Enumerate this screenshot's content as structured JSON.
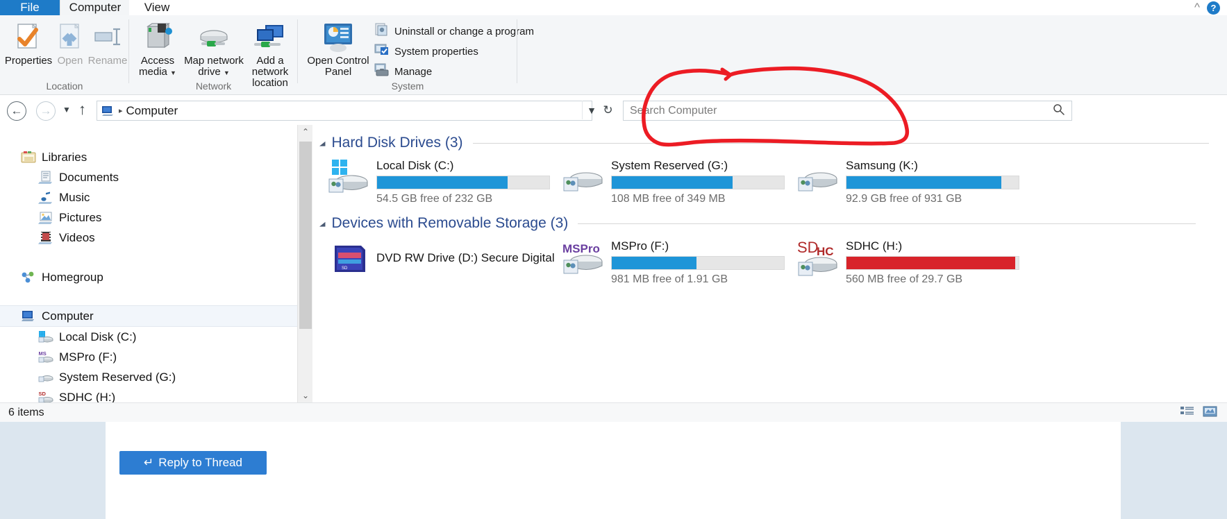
{
  "window": {
    "tabs": [
      {
        "label": "File",
        "state": "file"
      },
      {
        "label": "Computer",
        "state": "active"
      },
      {
        "label": "View",
        "state": "normal"
      }
    ],
    "minimize_icon": "chevron-up-icon",
    "help_icon": "help-icon",
    "help_glyph": "?"
  },
  "ribbon": {
    "groups": [
      {
        "name": "Location",
        "label": "Location",
        "buttons": [
          {
            "label": "Properties",
            "icon": "properties-icon",
            "enabled": true
          },
          {
            "label": "Open",
            "icon": "open-icon",
            "enabled": false
          },
          {
            "label": "Rename",
            "icon": "rename-icon",
            "enabled": false
          }
        ]
      },
      {
        "name": "Network",
        "label": "Network",
        "buttons": [
          {
            "label": "Access media",
            "icon": "access-media-icon",
            "enabled": true,
            "has_dropdown": true
          },
          {
            "label": "Map network drive",
            "icon": "map-network-drive-icon",
            "enabled": true,
            "has_dropdown": true
          },
          {
            "label": "Add a network location",
            "icon": "add-network-location-icon",
            "enabled": true,
            "has_dropdown": false
          }
        ]
      },
      {
        "name": "System",
        "label": "System",
        "big_button": {
          "label": "Open Control Panel",
          "icon": "control-panel-icon"
        },
        "items": [
          {
            "label": "Uninstall or change a program",
            "icon": "uninstall-program-icon"
          },
          {
            "label": "System properties",
            "icon": "system-properties-icon"
          },
          {
            "label": "Manage",
            "icon": "manage-icon"
          }
        ]
      }
    ]
  },
  "addressbar": {
    "back_icon": "back-arrow-icon",
    "forward_icon": "forward-arrow-icon",
    "history_icon": "chevron-down-icon",
    "up_icon": "up-arrow-icon",
    "breadcrumb_icon": "computer-icon",
    "breadcrumb_separator": "▸",
    "path": "Computer",
    "dropdown_icon": "chevron-down-icon",
    "refresh_icon": "refresh-icon",
    "refresh_glyph": "↻",
    "search_placeholder": "Search Computer",
    "search_icon": "search-icon",
    "search_glyph": "⌕"
  },
  "navpane": {
    "items": [
      {
        "label": "Libraries",
        "icon": "libraries-icon",
        "indent": 0,
        "selected": false
      },
      {
        "label": "Documents",
        "icon": "documents-icon",
        "indent": 1,
        "selected": false
      },
      {
        "label": "Music",
        "icon": "music-icon",
        "indent": 1,
        "selected": false
      },
      {
        "label": "Pictures",
        "icon": "pictures-icon",
        "indent": 1,
        "selected": false
      },
      {
        "label": "Videos",
        "icon": "videos-icon",
        "indent": 1,
        "selected": false
      },
      {
        "label": "Homegroup",
        "icon": "homegroup-icon",
        "indent": 0,
        "selected": false
      },
      {
        "label": "Computer",
        "icon": "computer-icon",
        "indent": 0,
        "selected": true
      },
      {
        "label": "Local Disk (C:)",
        "icon": "local-disk-icon",
        "indent": 1,
        "selected": false
      },
      {
        "label": "MSPro (F:)",
        "icon": "mspro-drive-icon",
        "indent": 1,
        "selected": false
      },
      {
        "label": "System Reserved (G:)",
        "icon": "system-reserved-icon",
        "indent": 1,
        "selected": false
      },
      {
        "label": "SDHC (H:)",
        "icon": "sdhc-drive-icon",
        "indent": 1,
        "selected": false
      }
    ],
    "scrollbar": {
      "up_glyph": "⌃",
      "down_glyph": "⌄"
    }
  },
  "content": {
    "groups": [
      {
        "title": "Hard Disk Drives (3)",
        "collapse_glyph": "◢",
        "drives": [
          {
            "name": "Local Disk (C:)",
            "icon": "windows-drive-icon",
            "free_text": "54.5 GB free of 232 GB",
            "used_percent": 76,
            "bar_color": "#1e95d8",
            "has_bar": true
          },
          {
            "name": "System Reserved (G:)",
            "icon": "hard-drive-icon",
            "free_text": "108 MB free of 349 MB",
            "used_percent": 70,
            "bar_color": "#1e95d8",
            "has_bar": true
          },
          {
            "name": "Samsung (K:)",
            "icon": "hard-drive-icon",
            "free_text": "92.9 GB free of 931 GB",
            "used_percent": 90,
            "bar_color": "#1e95d8",
            "has_bar": true
          }
        ]
      },
      {
        "title": "Devices with Removable Storage (3)",
        "collapse_glyph": "◢",
        "drives": [
          {
            "name": "DVD RW Drive (D:) Secure Digital",
            "icon": "dvd-drive-icon",
            "free_text": "",
            "used_percent": 0,
            "bar_color": "#1e95d8",
            "has_bar": false
          },
          {
            "name": "MSPro (F:)",
            "icon": "mspro-drive-icon",
            "icon_text": "MSPro",
            "free_text": "981 MB free of 1.91 GB",
            "used_percent": 49,
            "bar_color": "#1e95d8",
            "has_bar": true
          },
          {
            "name": "SDHC (H:)",
            "icon": "sdhc-drive-icon",
            "icon_text_a": "SD",
            "icon_text_b": "HC",
            "free_text": "560 MB free of 29.7 GB",
            "used_percent": 98,
            "bar_color": "#d8232a",
            "has_bar": true
          }
        ]
      }
    ]
  },
  "statusbar": {
    "item_count": "6 items",
    "details_view_icon": "details-view-icon",
    "large_icons_view_icon": "large-icons-view-icon"
  },
  "annotation": {
    "type": "hand-drawn-ellipse",
    "color": "#ec1c24",
    "target": "search-box"
  },
  "webpage": {
    "reply_button_label": "Reply to Thread",
    "reply_icon": "reply-icon"
  },
  "colors": {
    "accent_blue": "#1e95d8",
    "danger_red": "#d8232a",
    "group_heading": "#2b4b8f",
    "file_tab": "#1e7bc8",
    "annotation_red": "#ec1c24"
  }
}
